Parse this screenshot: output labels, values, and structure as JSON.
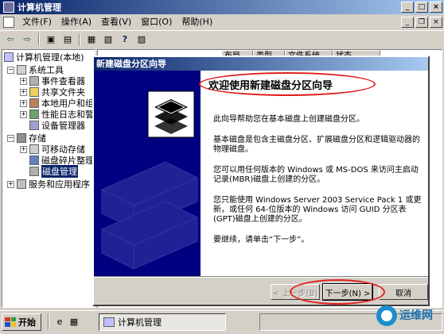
{
  "main_window": {
    "title": "计算机管理"
  },
  "menu": [
    "文件(F)",
    "操作(A)",
    "查看(V)",
    "窗口(O)",
    "帮助(H)"
  ],
  "tree": {
    "root": "计算机管理(本地)",
    "items": [
      {
        "label": "系统工具",
        "level": 1,
        "expander": "−"
      },
      {
        "label": "事件查看器",
        "level": 2,
        "expander": "+"
      },
      {
        "label": "共享文件夹",
        "level": 2,
        "expander": "+"
      },
      {
        "label": "本地用户和组",
        "level": 2,
        "expander": "+"
      },
      {
        "label": "性能日志和警",
        "level": 2,
        "expander": "+"
      },
      {
        "label": "设备管理器",
        "level": 2,
        "expander": ""
      },
      {
        "label": "存储",
        "level": 1,
        "expander": "−"
      },
      {
        "label": "可移动存储",
        "level": 2,
        "expander": "+"
      },
      {
        "label": "磁盘碎片整理",
        "level": 2,
        "expander": ""
      },
      {
        "label": "磁盘管理",
        "level": 2,
        "expander": "",
        "selected": true
      },
      {
        "label": "服务和应用程序",
        "level": 1,
        "expander": "+"
      }
    ]
  },
  "list_columns": [
    "布局",
    "类型",
    "文件系统",
    "状态"
  ],
  "wizard": {
    "title": "新建磁盘分区向导",
    "heading": "欢迎使用新建磁盘分区向导",
    "paragraphs": [
      "此向导帮助您在基本磁盘上创建磁盘分区。",
      "基本磁盘是包含主磁盘分区、扩展磁盘分区和逻辑驱动器的物理磁盘。",
      "您可以用任何版本的 Windows 或 MS-DOS 来访问主启动记录(MBR)磁盘上创建的分区。",
      "您只能使用 Windows Server 2003 Service Pack 1 或更新，或任何 64-位版本的 Windows 访问 GUID 分区表(GPT)磁盘上创建的分区。",
      "要继续，请单击“下一步”。"
    ],
    "buttons": {
      "back": "< 上一步(B)",
      "next": "下一步(N) >",
      "cancel": "取消"
    }
  },
  "taskbar": {
    "start": "开始",
    "task": "计算机管理"
  },
  "watermark": {
    "text": "运维网"
  },
  "colors": {
    "title_bar": "#0a246a",
    "wizard_side": "#000080",
    "highlight": "#e02020"
  }
}
